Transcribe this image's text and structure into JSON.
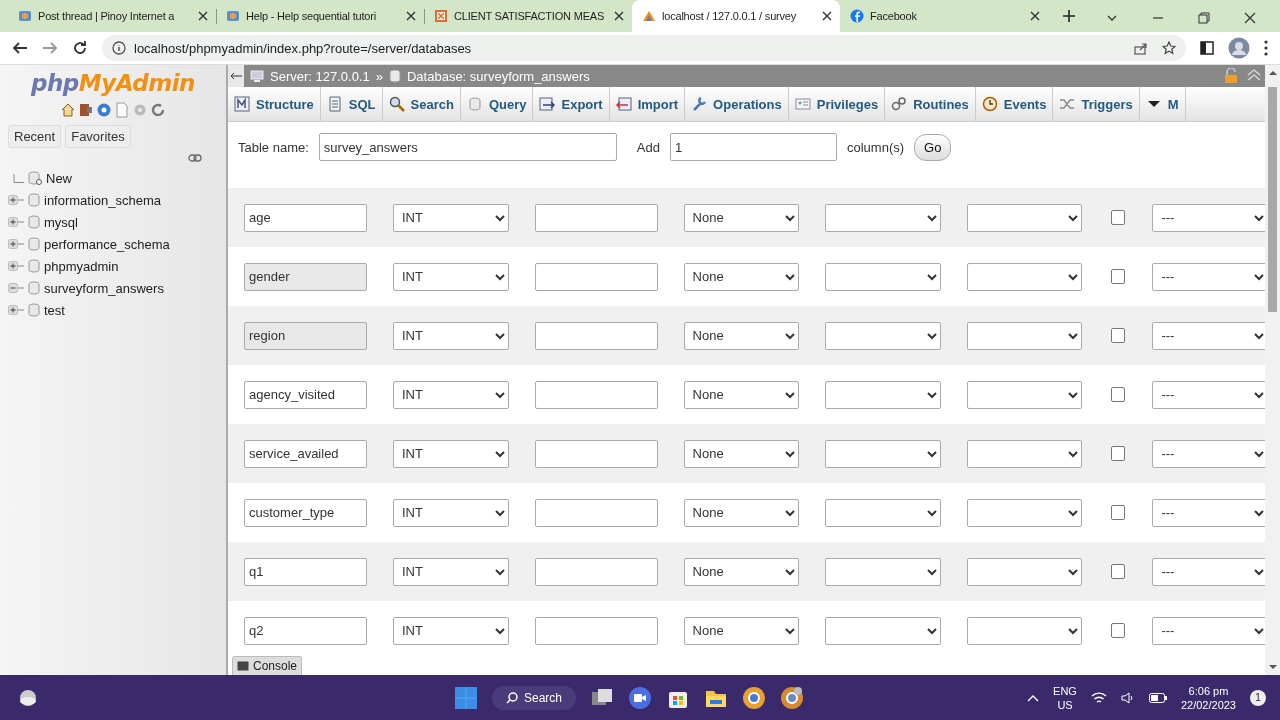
{
  "browser": {
    "tabs": [
      {
        "title": "Post thread | Pinoy Internet a",
        "selected": false
      },
      {
        "title": "Help - Help sequential tutori",
        "selected": false
      },
      {
        "title": "CLIENT SATISFACTION MEAS",
        "selected": false
      },
      {
        "title": "localhost / 127.0.0.1 / survey",
        "selected": true
      },
      {
        "title": "Facebook",
        "selected": false
      }
    ],
    "address": "localhost/phpmyadmin/index.php?route=/server/databases"
  },
  "sidebar": {
    "logo": {
      "prefix": "php",
      "name": "MyAdmin"
    },
    "buttons": [
      "Recent",
      "Favorites"
    ],
    "tree": [
      {
        "label": "New",
        "kind": "new"
      },
      {
        "label": "information_schema",
        "kind": "database",
        "expanded": false
      },
      {
        "label": "mysql",
        "kind": "database",
        "expanded": false
      },
      {
        "label": "performance_schema",
        "kind": "database",
        "expanded": false
      },
      {
        "label": "phpmyadmin",
        "kind": "database",
        "expanded": false
      },
      {
        "label": "surveyform_answers",
        "kind": "database",
        "expanded": true
      },
      {
        "label": "test",
        "kind": "database",
        "expanded": false
      }
    ]
  },
  "breadcrumb": {
    "server": "Server: 127.0.0.1",
    "separator": "»",
    "database": "Database: surveyform_answers"
  },
  "nav_tabs": [
    {
      "label": "Structure"
    },
    {
      "label": "SQL"
    },
    {
      "label": "Search"
    },
    {
      "label": "Query"
    },
    {
      "label": "Export"
    },
    {
      "label": "Import"
    },
    {
      "label": "Operations"
    },
    {
      "label": "Privileges"
    },
    {
      "label": "Routines"
    },
    {
      "label": "Events"
    },
    {
      "label": "Triggers"
    },
    {
      "label": "M"
    }
  ],
  "form": {
    "table_name_label": "Table name:",
    "table_name": "survey_answers",
    "add_label": "Add",
    "add_count": "1",
    "columns_label": "column(s)",
    "go": "Go"
  },
  "columns": [
    {
      "name": "age",
      "autofilled": false,
      "type": "INT",
      "default": "None",
      "null": false,
      "index": "---"
    },
    {
      "name": "gender",
      "autofilled": true,
      "type": "INT",
      "default": "None",
      "null": false,
      "index": "---"
    },
    {
      "name": "region",
      "autofilled": true,
      "type": "INT",
      "default": "None",
      "null": false,
      "index": "---"
    },
    {
      "name": "agency_visited",
      "autofilled": false,
      "type": "INT",
      "default": "None",
      "null": false,
      "index": "---"
    },
    {
      "name": "service_availed",
      "autofilled": false,
      "type": "INT",
      "default": "None",
      "null": false,
      "index": "---"
    },
    {
      "name": "customer_type",
      "autofilled": false,
      "type": "INT",
      "default": "None",
      "null": false,
      "index": "---"
    },
    {
      "name": "q1",
      "autofilled": false,
      "type": "INT",
      "default": "None",
      "null": false,
      "index": "---"
    },
    {
      "name": "q2",
      "autofilled": false,
      "type": "INT",
      "default": "None",
      "null": false,
      "index": "---"
    }
  ],
  "console": "Console",
  "taskbar": {
    "search": "Search",
    "language": "ENG",
    "region": "US",
    "time": "6:06 pm",
    "date": "22/02/2023",
    "notifications": "1"
  }
}
